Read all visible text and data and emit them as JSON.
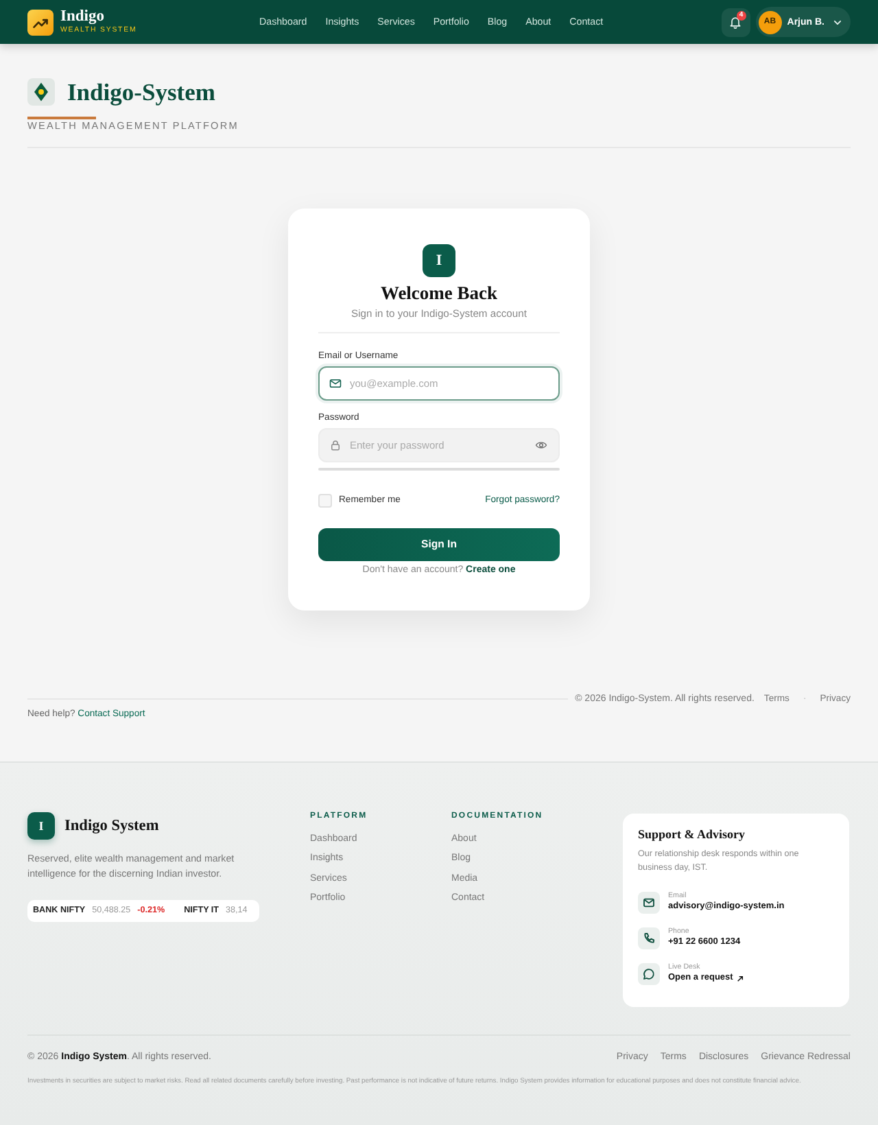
{
  "header": {
    "brand": {
      "name": "Indigo",
      "tagline": "WEALTH SYSTEM"
    },
    "nav": [
      {
        "label": "Dashboard",
        "selected": false
      },
      {
        "label": "Insights",
        "selected": false
      },
      {
        "label": "Services",
        "selected": false
      },
      {
        "label": "Portfolio",
        "selected": false
      },
      {
        "label": "Blog",
        "selected": false
      },
      {
        "label": "About",
        "selected": false
      },
      {
        "label": "Contact",
        "selected": false
      }
    ],
    "notifications": {
      "count": "4"
    },
    "user": {
      "initials": "AB",
      "name": "Arjun B."
    }
  },
  "hero": {
    "title": "Indigo-System",
    "subtitle": "WEALTH MANAGEMENT PLATFORM"
  },
  "login": {
    "logo_letter": "I",
    "title": "Welcome Back",
    "subtitle": "Sign in to your Indigo-System account",
    "fields": [
      {
        "kind": "email",
        "label": "Email or Username",
        "placeholder": "you@example.com",
        "focused": true
      },
      {
        "kind": "password",
        "label": "Password",
        "placeholder": "Enter your password",
        "focused": false
      }
    ],
    "remember": {
      "label": "Remember me",
      "checked": false
    },
    "forgot_link": "Forgot password?",
    "submit": "Sign In",
    "signup_prompt": "Don't have an account?",
    "signup_link": "Create one"
  },
  "page_bar": {
    "copyright": "© 2026 Indigo-System. All rights reserved.",
    "links": [
      "Terms",
      "Privacy"
    ],
    "separator": "·",
    "help_text": "Need help?",
    "help_link": "Contact Support"
  },
  "footer": {
    "brand": {
      "letter": "I",
      "name": "Indigo System",
      "description": "Reserved, elite wealth management and market intelligence for the discerning Indian investor."
    },
    "ticker": [
      {
        "symbol": "BANK NIFTY",
        "value": "50,488.25",
        "change": "-0.21%",
        "color": "#dc2626"
      },
      {
        "symbol": "NIFTY IT",
        "value": "38,14"
      }
    ],
    "columns": [
      {
        "heading": "PLATFORM",
        "links": [
          "Dashboard",
          "Insights",
          "Services",
          "Portfolio"
        ]
      },
      {
        "heading": "DOCUMENTATION",
        "links": [
          "About",
          "Blog",
          "Media",
          "Contact"
        ]
      }
    ],
    "support": {
      "title": "Support & Advisory",
      "description": "Our relationship desk responds within one business day, IST.",
      "contacts": [
        {
          "kind": "email",
          "label": "Email",
          "value": "advisory@indigo-system.in",
          "external": false
        },
        {
          "kind": "phone",
          "label": "Phone",
          "value": "+91 22 6600 1234",
          "external": false
        },
        {
          "kind": "chat",
          "label": "Live Desk",
          "value": "Open a request",
          "external": true
        }
      ]
    },
    "bottom": {
      "copyright": "© 2026 **Indigo System**. All rights reserved.",
      "links": [
        "Privacy",
        "Terms",
        "Disclosures",
        "Grievance Redressal"
      ],
      "disclaimer": "Investments in securities are subject to market risks. Read all related documents carefully before investing. Past performance is not indicative of future returns. Indigo System provides information for educational purposes and does not constitute financial advice."
    }
  }
}
